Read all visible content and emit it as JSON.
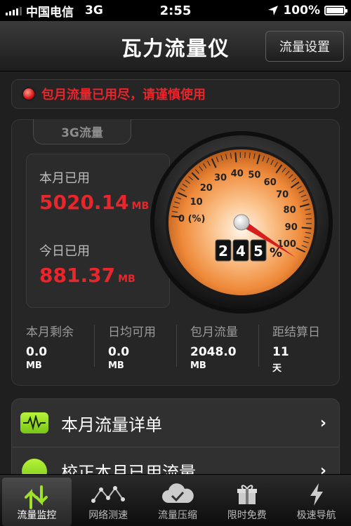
{
  "status_bar": {
    "carrier": "中国电信",
    "network": "3G",
    "time": "2:55",
    "battery": "100%"
  },
  "nav": {
    "title": "瓦力流量仪",
    "settings_button": "流量设置"
  },
  "warning": {
    "text": "包月流量已用尽，请谨慎使用",
    "color": "#e8252a"
  },
  "network_tab": "3G流量",
  "usage": {
    "month_label": "本月已用",
    "month_value": "5020.14",
    "month_unit": "MB",
    "today_label": "今日已用",
    "today_value": "881.37",
    "today_unit": "MB"
  },
  "gauge": {
    "ticks": [
      "0 (%)",
      "10",
      "20",
      "30",
      "40",
      "50",
      "60",
      "70",
      "80",
      "90",
      "100"
    ],
    "digits": [
      "2",
      "4",
      "5"
    ],
    "percent_sign": "%",
    "value_percent": 245
  },
  "stats": [
    {
      "label": "本月剩余",
      "value": "0.0",
      "unit": "MB"
    },
    {
      "label": "日均可用",
      "value": "0.0",
      "unit": "MB"
    },
    {
      "label": "包月流量",
      "value": "2048.0",
      "unit": "MB"
    },
    {
      "label": "距结算日",
      "value": "11",
      "unit": "天"
    }
  ],
  "list": [
    {
      "label": "本月流量详单",
      "icon": "pulse-icon"
    },
    {
      "label": "校正本月已用流量",
      "icon": "calibrate-icon"
    }
  ],
  "tabs": [
    {
      "label": "流量监控",
      "icon": "traffic-monitor-icon",
      "active": true
    },
    {
      "label": "网络测速",
      "icon": "speed-test-icon",
      "active": false
    },
    {
      "label": "流量压缩",
      "icon": "cloud-compress-icon",
      "active": false
    },
    {
      "label": "限时免费",
      "icon": "gift-icon",
      "active": false
    },
    {
      "label": "极速导航",
      "icon": "lightning-icon",
      "active": false
    }
  ],
  "colors": {
    "accent_red": "#e8262b",
    "accent_green": "#9ee02a",
    "gauge_orange": "#f08a3c"
  }
}
